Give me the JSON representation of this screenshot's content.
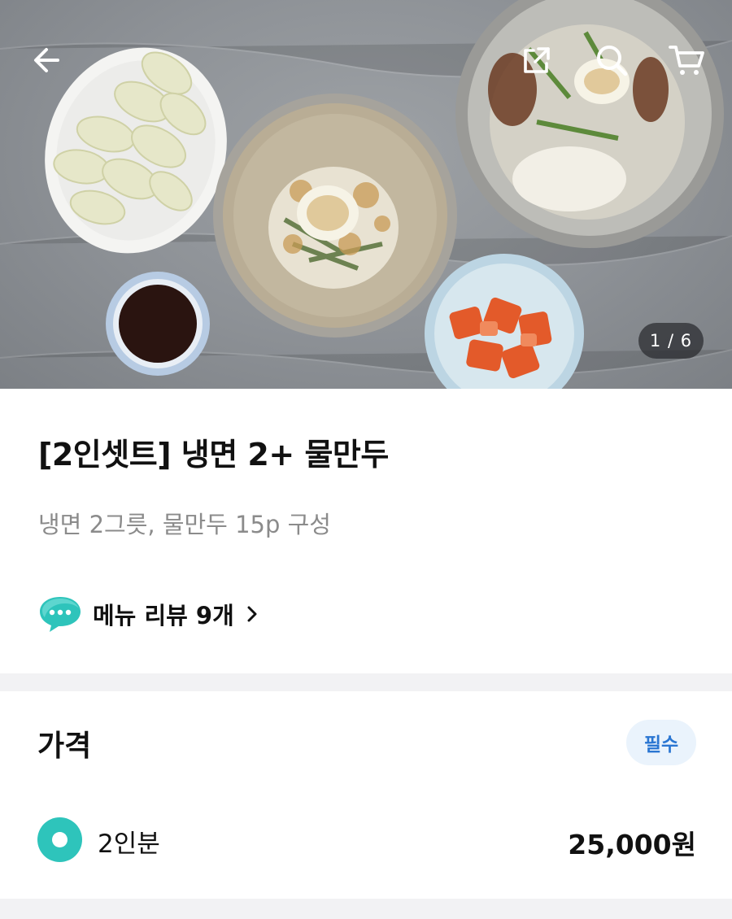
{
  "hero": {
    "image_counter": "1 / 6"
  },
  "topbar": {
    "icons": [
      "back-arrow-icon",
      "share-icon",
      "search-icon",
      "cart-icon"
    ]
  },
  "product": {
    "title": "[2인셋트] 냉면 2+ 물만두",
    "description": "냉면 2그릇, 물만두 15p 구성",
    "review_link": "메뉴 리뷰 9개"
  },
  "price_section": {
    "label": "가격",
    "badge": "필수",
    "options": [
      {
        "name": "2인분",
        "price": "25,000원",
        "selected": true
      }
    ]
  },
  "colors": {
    "accent_teal": "#2ec4bb",
    "badge_blue": "#2a76d2",
    "badge_bg": "#eaf3fc",
    "subtext_gray": "#8b8b8b"
  }
}
